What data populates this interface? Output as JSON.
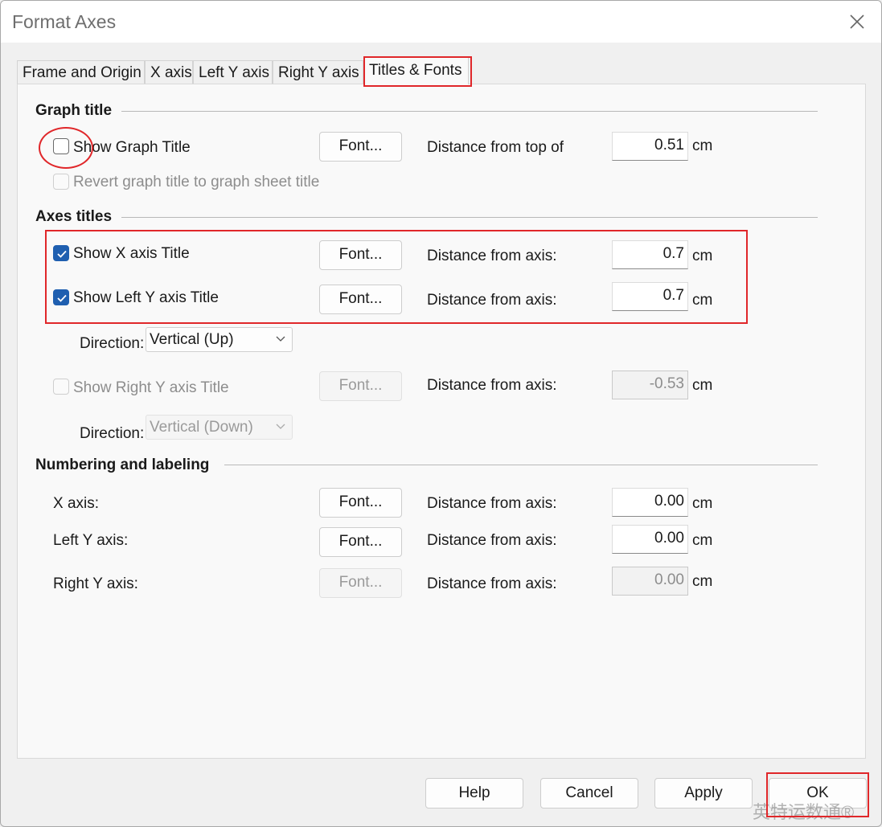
{
  "window": {
    "title": "Format Axes"
  },
  "tabs": [
    {
      "label": "Frame and Origin"
    },
    {
      "label": "X axis"
    },
    {
      "label": "Left Y axis"
    },
    {
      "label": "Right Y axis"
    },
    {
      "label": "Titles & Fonts",
      "active": true
    }
  ],
  "graph_title": {
    "heading": "Graph title",
    "show_label": "Show Graph Title",
    "show_checked": false,
    "font_label": "Font...",
    "distance_label": "Distance from top of",
    "distance_value": "0.51",
    "unit": "cm",
    "revert_label": "Revert graph title to graph sheet title"
  },
  "axes_titles": {
    "heading": "Axes titles",
    "x": {
      "show_label": "Show X axis Title",
      "checked": true,
      "font_label": "Font...",
      "distance_label": "Distance from axis:",
      "distance_value": "0.7",
      "unit": "cm"
    },
    "left_y": {
      "show_label": "Show Left Y axis Title",
      "checked": true,
      "font_label": "Font...",
      "distance_label": "Distance from axis:",
      "distance_value": "0.7",
      "unit": "cm",
      "direction_label": "Direction:",
      "direction_value": "Vertical (Up)"
    },
    "right_y": {
      "show_label": "Show Right Y axis Title",
      "checked": false,
      "font_label": "Font...",
      "distance_label": "Distance from axis:",
      "distance_value": "-0.53",
      "unit": "cm",
      "direction_label": "Direction:",
      "direction_value": "Vertical (Down)"
    }
  },
  "numbering": {
    "heading": "Numbering and labeling",
    "rows": [
      {
        "label": "X axis:",
        "font_label": "Font...",
        "distance_label": "Distance from axis:",
        "value": "0.00",
        "unit": "cm"
      },
      {
        "label": "Left Y axis:",
        "font_label": "Font...",
        "distance_label": "Distance from axis:",
        "value": "0.00",
        "unit": "cm"
      },
      {
        "label": "Right Y axis:",
        "font_label": "Font...",
        "distance_label": "Distance from axis:",
        "value": "0.00",
        "unit": "cm"
      }
    ]
  },
  "footer": {
    "help": "Help",
    "cancel": "Cancel",
    "apply": "Apply",
    "ok": "OK"
  },
  "watermark": {
    "text": "英特运数通®"
  },
  "colors": {
    "accent": "#1f5fb0",
    "highlight": "#e0272a"
  }
}
